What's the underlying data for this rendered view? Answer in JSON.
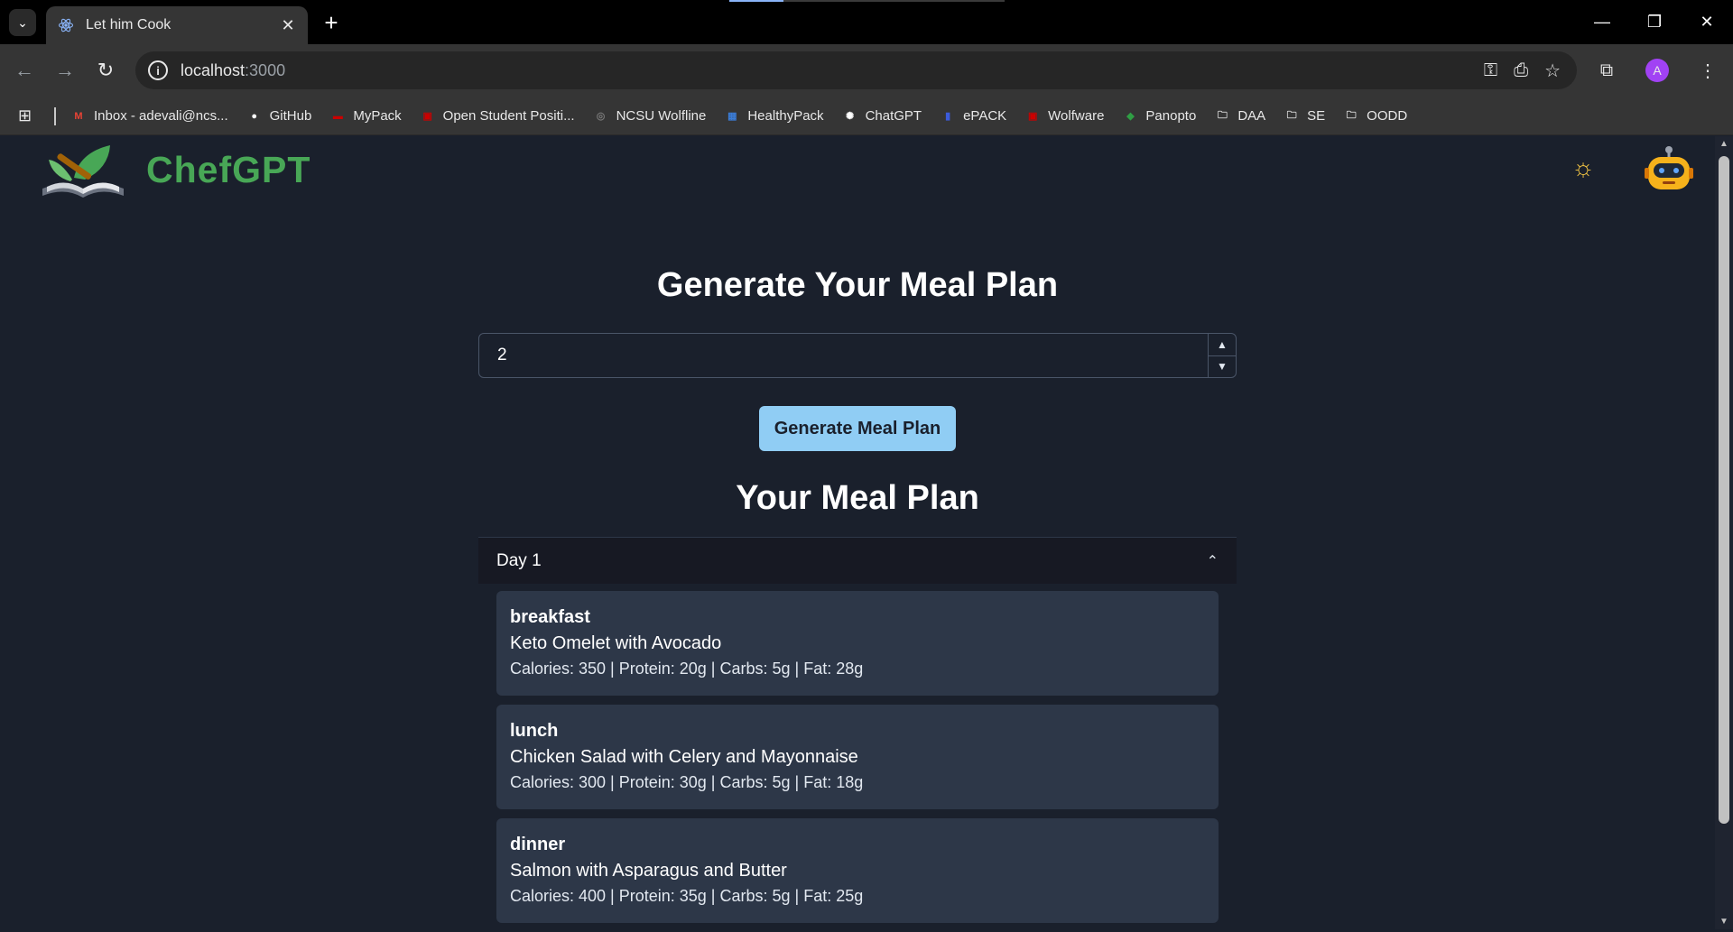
{
  "browser": {
    "tab_title": "Let him Cook",
    "url_host": "localhost",
    "url_port": ":3000",
    "profile_initial": "A",
    "bookmarks": [
      {
        "label": "Inbox - adevali@ncs...",
        "icon": "gmail-icon",
        "color": "#ea4335"
      },
      {
        "label": "GitHub",
        "icon": "github-icon",
        "color": "#ffffff"
      },
      {
        "label": "MyPack",
        "icon": "mypack-icon",
        "color": "#cc0000"
      },
      {
        "label": "Open Student Positi...",
        "icon": "ncsu-icon",
        "color": "#cc0000"
      },
      {
        "label": "NCSU Wolfline",
        "icon": "wolfline-icon",
        "color": "#777777"
      },
      {
        "label": "HealthyPack",
        "icon": "healthypack-icon",
        "color": "#3b7dd8"
      },
      {
        "label": "ChatGPT",
        "icon": "chatgpt-icon",
        "color": "#ffffff"
      },
      {
        "label": "ePACK",
        "icon": "epack-icon",
        "color": "#3b5bdb"
      },
      {
        "label": "Wolfware",
        "icon": "wolfware-icon",
        "color": "#cc0000"
      },
      {
        "label": "Panopto",
        "icon": "panopto-icon",
        "color": "#2f9e44"
      },
      {
        "label": "DAA",
        "icon": "folder-icon",
        "color": "#e8e8e8"
      },
      {
        "label": "SE",
        "icon": "folder-icon",
        "color": "#e8e8e8"
      },
      {
        "label": "OODD",
        "icon": "folder-icon",
        "color": "#e8e8e8"
      }
    ]
  },
  "app": {
    "brand": "ChefGPT",
    "heading": "Generate Your Meal Plan",
    "days_input_value": "2",
    "generate_button": "Generate Meal Plan",
    "plan_heading": "Your Meal Plan",
    "days": [
      {
        "label": "Day 1",
        "meals": [
          {
            "type": "breakfast",
            "name": "Keto Omelet with Avocado",
            "macros": "Calories: 350 | Protein: 20g | Carbs: 5g | Fat: 28g"
          },
          {
            "type": "lunch",
            "name": "Chicken Salad with Celery and Mayonnaise",
            "macros": "Calories: 300 | Protein: 30g | Carbs: 5g | Fat: 18g"
          },
          {
            "type": "dinner",
            "name": "Salmon with Asparagus and Butter",
            "macros": "Calories: 400 | Protein: 35g | Carbs: 5g | Fat: 25g"
          }
        ]
      }
    ]
  },
  "colors": {
    "brand_green": "#48a756",
    "button_blue": "#90cdf4",
    "page_bg": "#1a202c",
    "card_bg": "#2d3748"
  }
}
